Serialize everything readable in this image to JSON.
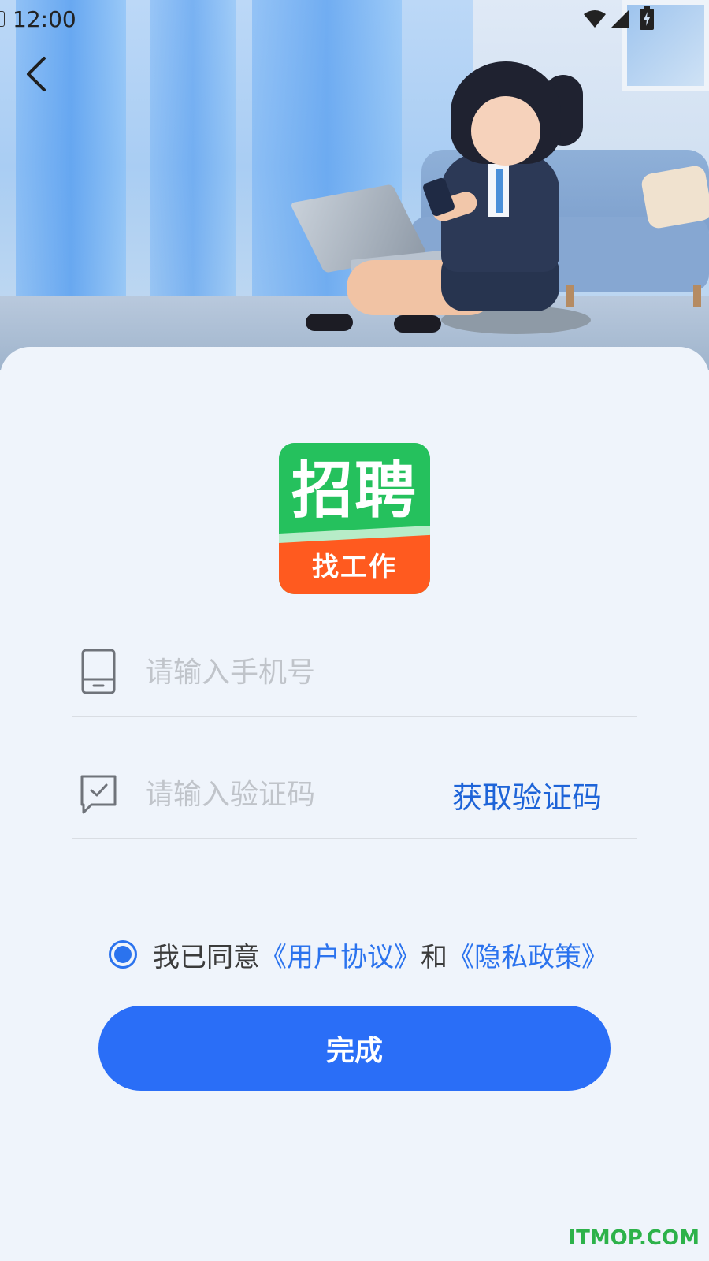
{
  "status_bar": {
    "time": "12:00"
  },
  "header": {
    "back_icon": "chevron-left-icon"
  },
  "logo": {
    "main_text": "招聘",
    "sub_text": "找工作"
  },
  "form": {
    "phone": {
      "placeholder": "请输入手机号",
      "value": "",
      "icon": "phone-icon"
    },
    "code": {
      "placeholder": "请输入验证码",
      "value": "",
      "icon": "message-check-icon",
      "get_code_label": "获取验证码"
    }
  },
  "agreement": {
    "checked": true,
    "prefix": "我已同意",
    "user_agreement": "《用户协议》",
    "and": "和",
    "privacy_policy": "《隐私政策》"
  },
  "submit_label": "完成",
  "watermark": "ITMOP.COM",
  "colors": {
    "primary": "#2a6ef7",
    "link": "#2b73ee",
    "logo_green": "#25c15d",
    "logo_orange": "#ff5a1f"
  }
}
